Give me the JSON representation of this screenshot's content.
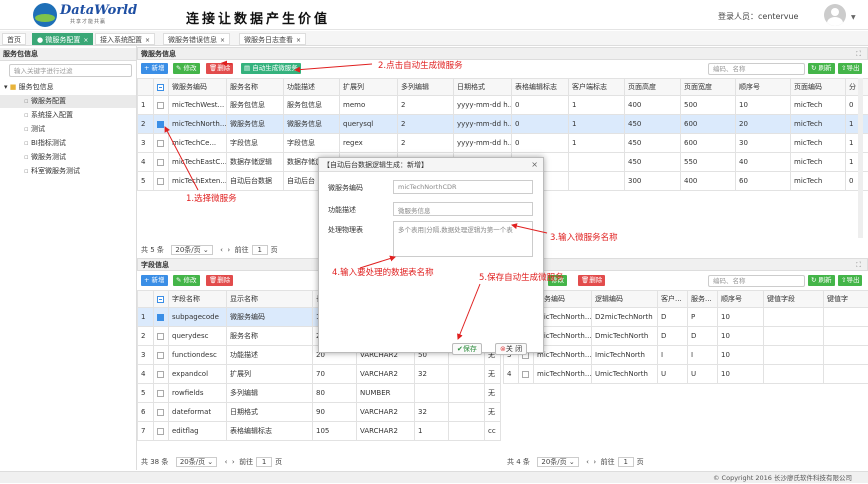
{
  "header": {
    "logo_text": "DataWorld",
    "logo_sub": "共享才能共赢",
    "slogan": "连接让数据产生价值",
    "user_label": "登录人员：centervue"
  },
  "tabs": [
    {
      "label": "首页"
    },
    {
      "label": "微服务配置",
      "active": true
    },
    {
      "label": "接入系统配置"
    },
    {
      "label": "微服务错误信息"
    },
    {
      "label": "微服务日志查看"
    }
  ],
  "sidebar": {
    "title": "服务包信息",
    "filter_placeholder": "输入关键字进行过滤",
    "root": "服务包信息",
    "items": [
      "微服务配置",
      "系统接入配置",
      "测试",
      "BI指标测试",
      "微服务测试",
      "科室微服务测试"
    ]
  },
  "top_panel": {
    "title": "微服务信息",
    "buttons": {
      "add": "+ 新增",
      "edit": "修改",
      "delete": "删除",
      "auto": "自动生成微服务",
      "refresh": "刷新",
      "export": "导出"
    },
    "search_placeholder": "编码、名称",
    "columns": [
      "",
      "",
      "微服务编码",
      "服务名称",
      "功能描述",
      "扩展列",
      "多列编辑",
      "日期格式",
      "表格编辑标志",
      "客户端标志",
      "页面高度",
      "页面宽度",
      "顺序号",
      "页面编码",
      "分"
    ],
    "rows": [
      [
        "1",
        "",
        "micTechWest...",
        "服务包信息",
        "服务包信息",
        "memo",
        "2",
        "yyyy-mm-dd h...",
        "0",
        "1",
        "400",
        "500",
        "10",
        "micTech",
        "0"
      ],
      [
        "2",
        "on",
        "micTechNorth...",
        "微服务信息",
        "微服务信息",
        "querysql",
        "2",
        "yyyy-mm-dd h...",
        "0",
        "1",
        "450",
        "600",
        "20",
        "micTech",
        "1"
      ],
      [
        "3",
        "",
        "micTechCe...",
        "字段信息",
        "字段信息",
        "regex",
        "2",
        "yyyy-mm-dd h...",
        "0",
        "1",
        "450",
        "600",
        "30",
        "micTech",
        "1"
      ],
      [
        "4",
        "",
        "micTechEastC...",
        "数据存储逻辑",
        "数据存储逻",
        "",
        "",
        "",
        "",
        "",
        "450",
        "550",
        "40",
        "micTech",
        "1"
      ],
      [
        "5",
        "",
        "micTechExten...",
        "自动后台数据",
        "自动后台",
        "",
        "",
        "",
        "",
        "",
        "300",
        "400",
        "60",
        "micTech",
        "0"
      ]
    ],
    "pager": {
      "total": "共 5 条",
      "size": "20条/页",
      "goto": "前往",
      "page": "1",
      "unit": "页"
    }
  },
  "field_panel": {
    "title": "字段信息",
    "buttons": {
      "add": "+ 新增",
      "edit": "修改",
      "delete": "删除"
    },
    "columns": [
      "",
      "",
      "字段名称",
      "显示名称",
      "长",
      "字段类型",
      "长度",
      "",
      "无"
    ],
    "rows": [
      [
        "1",
        "on",
        "subpagecode",
        "微服务编码",
        "1",
        "",
        "",
        "",
        "无"
      ],
      [
        "2",
        "",
        "querydesc",
        "服务名称",
        "20",
        "VARCHAR2",
        "50",
        "",
        "无"
      ],
      [
        "3",
        "",
        "functiondesc",
        "功能描述",
        "20",
        "VARCHAR2",
        "50",
        "",
        "无"
      ],
      [
        "4",
        "",
        "expandcol",
        "扩展列",
        "70",
        "VARCHAR2",
        "32",
        "",
        "无"
      ],
      [
        "5",
        "",
        "rowfields",
        "多列编辑",
        "80",
        "NUMBER",
        "",
        "",
        "无"
      ],
      [
        "6",
        "",
        "dateformat",
        "日期格式",
        "90",
        "VARCHAR2",
        "32",
        "",
        "无"
      ],
      [
        "7",
        "",
        "editflag",
        "表格编辑标志",
        "105",
        "VARCHAR2",
        "1",
        "",
        "cc"
      ]
    ],
    "pager": {
      "total": "共 38 条",
      "size": "20条/页",
      "goto": "前往",
      "page": "1",
      "unit": "页"
    }
  },
  "logic_panel": {
    "buttons": {
      "add": "新增",
      "edit": "修改",
      "delete": "删除"
    },
    "search_placeholder": "编码、名称",
    "columns": [
      "",
      "",
      "服务编码",
      "逻辑编码",
      "客户...",
      "服务...",
      "顺序号",
      "键值字段",
      "键值字"
    ],
    "rows": [
      [
        "1",
        "",
        "micTechNorth...",
        "D2micTechNorth",
        "D",
        "P",
        "10",
        "",
        ""
      ],
      [
        "2",
        "",
        "micTechNorth...",
        "DmicTechNorth",
        "D",
        "D",
        "10",
        "",
        ""
      ],
      [
        "3",
        "",
        "micTechNorth...",
        "ImicTechNorth",
        "I",
        "I",
        "10",
        "",
        ""
      ],
      [
        "4",
        "",
        "micTechNorth...",
        "UmicTechNorth",
        "U",
        "U",
        "10",
        "",
        ""
      ]
    ],
    "pager": {
      "total": "共 4 条",
      "size": "20条/页",
      "goto": "前往",
      "page": "1",
      "unit": "页"
    }
  },
  "dialog": {
    "title": "【自动后台数据逻辑生成：新增】",
    "close": "×",
    "code_label": "微服务编码",
    "code_value": "micTechNorthCDR",
    "func_label": "功能描述",
    "func_value": "微服务信息",
    "logic_label": "处理物理表",
    "logic_value": "多个表用|分隔,数据处理逻辑为第一个表",
    "save": "保存",
    "close_btn": "关 闭"
  },
  "annotations": {
    "a1": "1.选择微服务",
    "a2": "2.点击自动生成微服务",
    "a3": "3.输入微服务名称",
    "a4": "4.输入要处理的数据表名称",
    "a5": "5.保存自动生成微服务"
  },
  "footer": "© Copyright 2016 长沙廖氏软件科技有限公司",
  "colors": {
    "accent": "#3aa776",
    "annotation": "#e02020",
    "blue": "#3a8ee6",
    "red": "#e24c4c"
  }
}
